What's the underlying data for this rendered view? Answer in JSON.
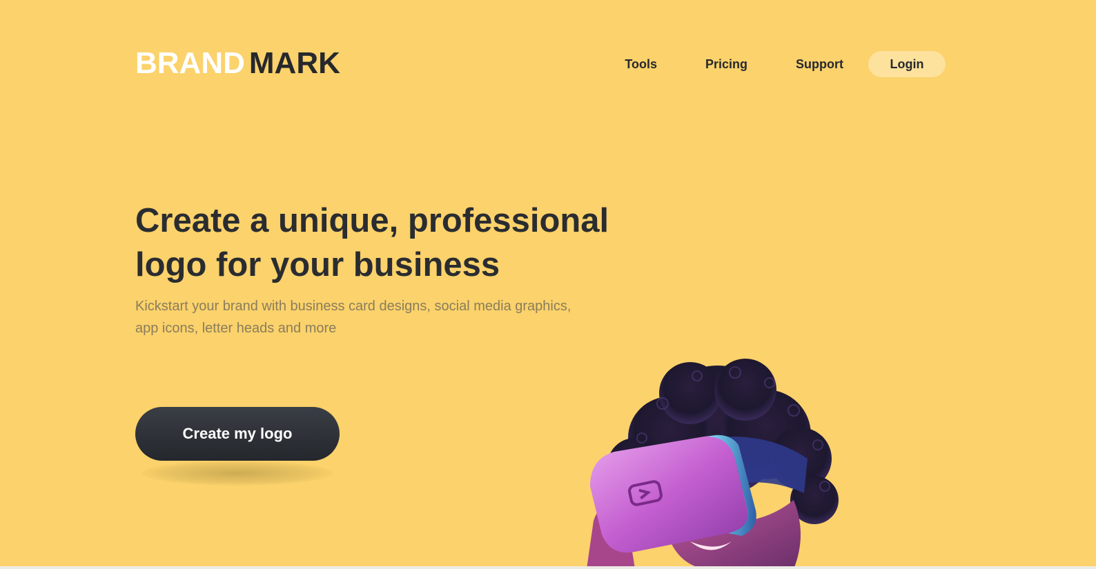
{
  "header": {
    "logo": {
      "brand": "BRAND",
      "mark": "MARK"
    },
    "nav": [
      {
        "label": "Tools"
      },
      {
        "label": "Pricing"
      },
      {
        "label": "Support"
      }
    ],
    "login_label": "Login"
  },
  "hero": {
    "title_line1": "Create a unique, professional",
    "title_line2": "logo for your business",
    "subtitle_line1": "Kickstart your brand with business card designs, social media graphics,",
    "subtitle_line2": "app icons, letter heads and more",
    "cta_label": "Create my logo"
  },
  "colors": {
    "background": "#fbd26b",
    "text_dark": "#2a2c30",
    "subtitle": "#8a7d5c",
    "login_pill": "#fde29d",
    "cta_bg": "#2c2f35",
    "headset": "#c45fd0"
  },
  "images": {
    "hero": "person-with-vr-headset"
  }
}
